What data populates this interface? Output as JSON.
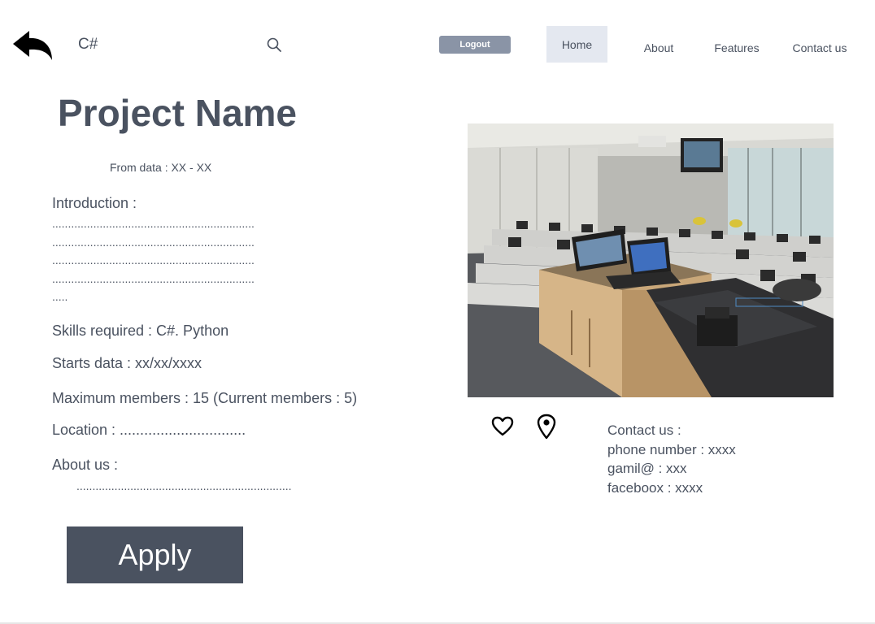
{
  "header": {
    "brand": "C#",
    "logout_label": "Logout",
    "nav": {
      "home": "Home",
      "about": "About",
      "features": "Features",
      "contact": "Contact us"
    }
  },
  "project": {
    "title": "Project Name",
    "from_date": "From data : XX - XX",
    "intro_label": "Introduction :",
    "intro_dots": "................................................................\n................................................................\n................................................................\n................................................................\n.....",
    "skills": "Skills required :  C#. Python",
    "starts": "Starts data :  xx/xx/xxxx",
    "max_members": "Maximum members : 15  (Current members : 5)",
    "location": "Location : ...............................",
    "about_label": "About us :",
    "about_dots": "...................................................................."
  },
  "apply_label": "Apply",
  "contact": {
    "heading": "Contact us :",
    "phone": "phone number : xxxx",
    "gmail": "gamil@ : xxx",
    "facebook": "faceboox : xxxx"
  },
  "icons": [
    "back-arrow-icon",
    "search-icon",
    "heart-icon",
    "location-pin-icon"
  ]
}
